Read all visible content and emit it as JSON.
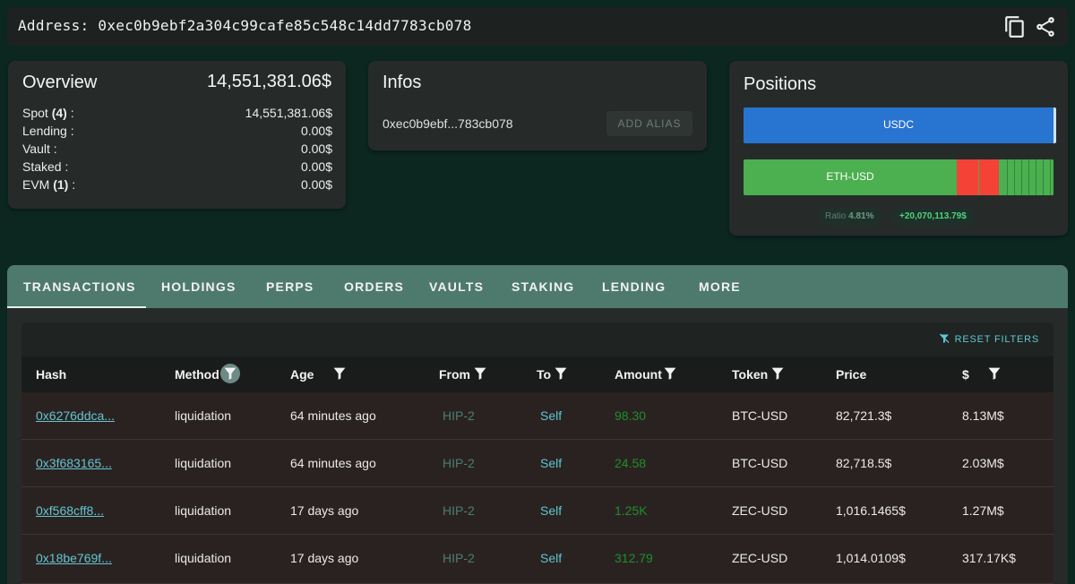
{
  "header": {
    "address": "Address: 0xec0b9ebf2a304c99cafe85c548c14dd7783cb078",
    "copy_icon": "copy-icon",
    "share_icon": "share-icon"
  },
  "overview": {
    "title": "Overview",
    "total": "14,551,381.06$",
    "rows": [
      {
        "label": "Spot",
        "count": "(4)",
        "suffix": " :",
        "value": "14,551,381.06$"
      },
      {
        "label": "Lending :",
        "count": "",
        "suffix": "",
        "value": "0.00$"
      },
      {
        "label": "Vault :",
        "count": "",
        "suffix": "",
        "value": "0.00$"
      },
      {
        "label": "Staked :",
        "count": "",
        "suffix": "",
        "value": "0.00$"
      },
      {
        "label": "EVM",
        "count": "(1)",
        "suffix": " :",
        "value": "0.00$"
      }
    ]
  },
  "infos": {
    "title": "Infos",
    "short_address": "0xec0b9ebf...783cb078",
    "add_alias_label": "ADD ALIAS"
  },
  "positions": {
    "title": "Positions",
    "usdc_label": "USDC",
    "eth_label": "ETH-USD",
    "ratio_label": "Ratio",
    "ratio_value": "4.81%",
    "pnl": "+20,070,113.79$",
    "colors": {
      "usdc": "#2874d1",
      "long": "#4caf50",
      "short": "#f44336"
    }
  },
  "tabs": [
    "TRANSACTIONS",
    "HOLDINGS",
    "PERPS",
    "ORDERS",
    "VAULTS",
    "STAKING",
    "LENDING",
    "MORE"
  ],
  "table": {
    "reset_filters_label": "RESET FILTERS",
    "headers": {
      "hash": "Hash",
      "method": "Method",
      "age": "Age",
      "from": "From",
      "to": "To",
      "amount": "Amount",
      "token": "Token",
      "price": "Price",
      "usd": "$"
    },
    "rows": [
      {
        "hash": "0x6276ddca...",
        "method": "liquidation",
        "age": "64 minutes ago",
        "from": "HIP-2",
        "to": "Self",
        "amount": "98.30",
        "token": "BTC-USD",
        "price": "82,721.3$",
        "usd": "8.13M$"
      },
      {
        "hash": "0x3f683165...",
        "method": "liquidation",
        "age": "64 minutes ago",
        "from": "HIP-2",
        "to": "Self",
        "amount": "24.58",
        "token": "BTC-USD",
        "price": "82,718.5$",
        "usd": "2.03M$"
      },
      {
        "hash": "0xf568cff8...",
        "method": "liquidation",
        "age": "17 days ago",
        "from": "HIP-2",
        "to": "Self",
        "amount": "1.25K",
        "token": "ZEC-USD",
        "price": "1,016.1465$",
        "usd": "1.27M$"
      },
      {
        "hash": "0x18be769f...",
        "method": "liquidation",
        "age": "17 days ago",
        "from": "HIP-2",
        "to": "Self",
        "amount": "312.79",
        "token": "ZEC-USD",
        "price": "1,014.0109$",
        "usd": "317.17K$"
      }
    ]
  }
}
